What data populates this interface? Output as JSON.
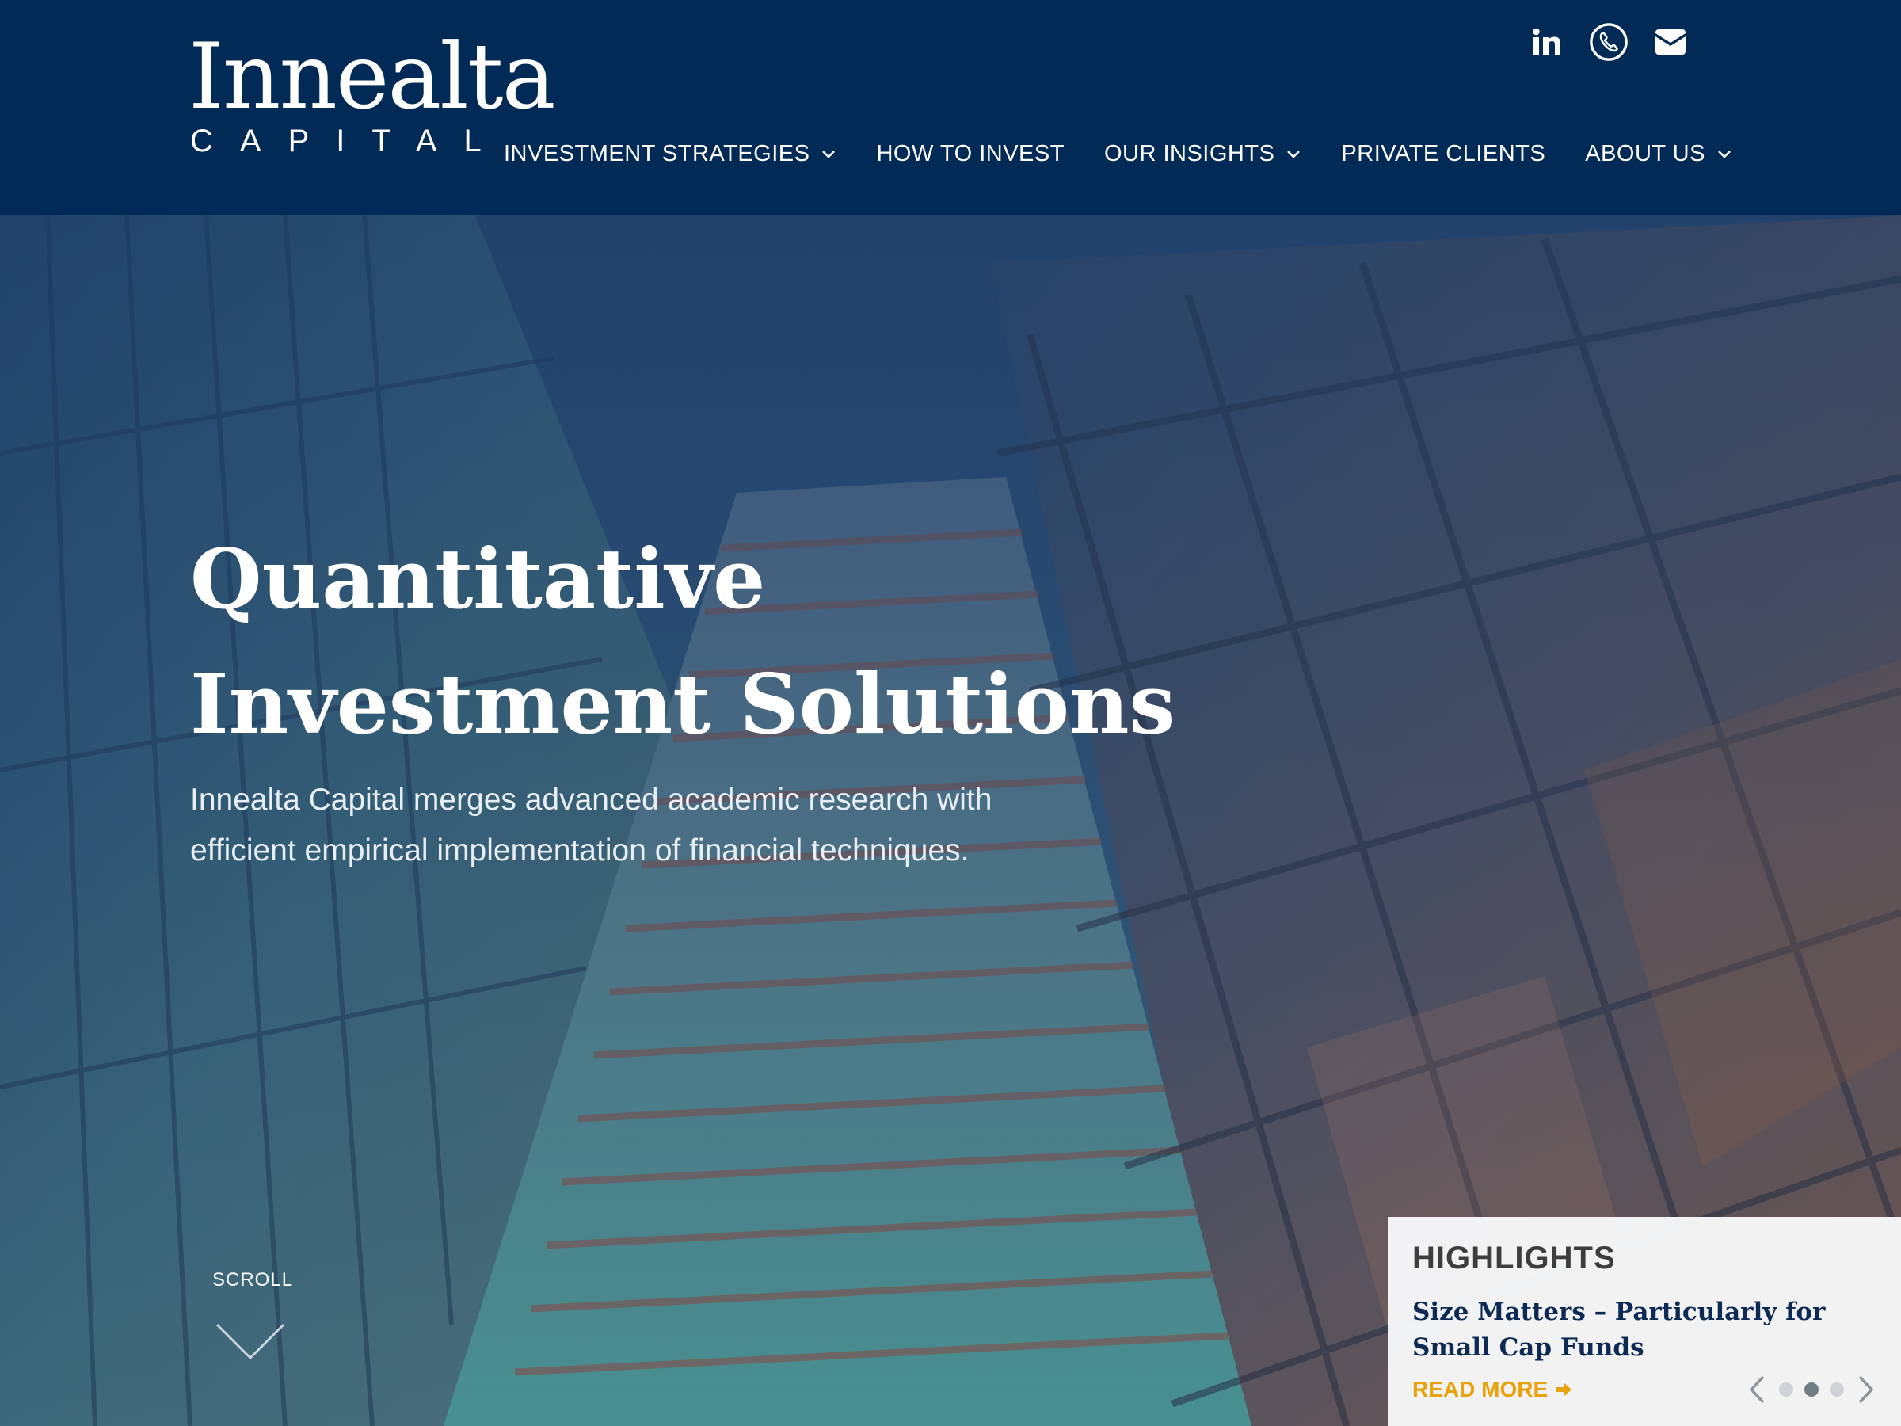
{
  "brand": {
    "name": "Innealta",
    "subtitle": "CAPITAL"
  },
  "social": [
    {
      "icon": "linkedin-icon",
      "label": "in"
    },
    {
      "icon": "phone-icon"
    },
    {
      "icon": "envelope-icon"
    }
  ],
  "nav": {
    "items": [
      {
        "label": "INVESTMENT STRATEGIES",
        "has_dropdown": true
      },
      {
        "label": "HOW TO INVEST",
        "has_dropdown": false
      },
      {
        "label": "OUR INSIGHTS",
        "has_dropdown": true
      },
      {
        "label": "PRIVATE CLIENTS",
        "has_dropdown": false
      },
      {
        "label": "ABOUT US",
        "has_dropdown": true
      }
    ]
  },
  "hero": {
    "title_line1": "Quantitative",
    "title_line2": "Investment Solutions",
    "text": "Innealta Capital merges advanced academic research with efficient empirical implementation of financial techniques.",
    "scroll_label": "SCROLL"
  },
  "highlights": {
    "heading": "HIGHLIGHTS",
    "title": "Size Matters – Particularly for Small Cap Funds",
    "read_more": "READ MORE",
    "active_slide": 2,
    "slide_count": 3
  },
  "colors": {
    "header_bg": "#022a56",
    "accent": "#e8a20c",
    "highlight_title": "#0d2a55"
  }
}
